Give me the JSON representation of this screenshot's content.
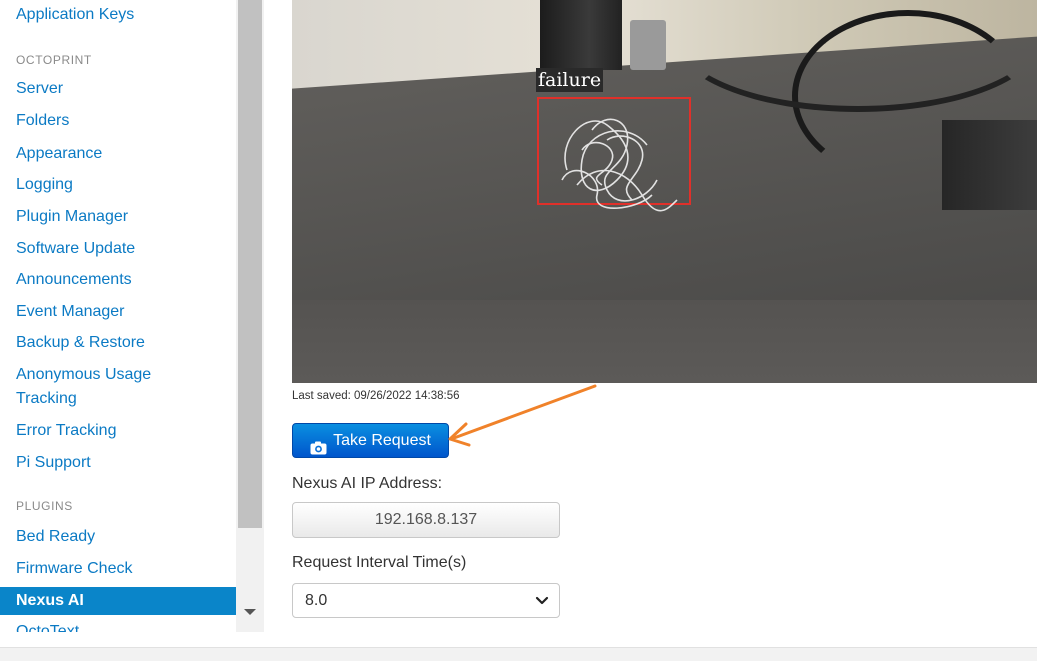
{
  "sidebar": {
    "items": [
      {
        "label": "Application Keys"
      },
      {
        "label": "Server"
      },
      {
        "label": "Folders"
      },
      {
        "label": "Appearance"
      },
      {
        "label": "Logging"
      },
      {
        "label": "Plugin Manager"
      },
      {
        "label": "Software Update"
      },
      {
        "label": "Announcements"
      },
      {
        "label": "Event Manager"
      },
      {
        "label": "Backup & Restore"
      },
      {
        "label": "Anonymous Usage Tracking"
      },
      {
        "label": "Error Tracking"
      },
      {
        "label": "Pi Support"
      },
      {
        "label": "Bed Ready"
      },
      {
        "label": "Firmware Check"
      },
      {
        "label": "Nexus AI"
      },
      {
        "label": "OctoText"
      }
    ],
    "sections": {
      "octoprint": "OCTOPRINT",
      "plugins": "PLUGINS"
    },
    "active_item": "Nexus AI"
  },
  "camera": {
    "detection_label": "failure",
    "last_saved": "Last saved: 09/26/2022 14:38:56"
  },
  "actions": {
    "take_request_label": "Take Request",
    "take_request_icon": "camera-icon"
  },
  "form": {
    "ip_label": "Nexus AI IP Address:",
    "ip_value": "192.168.8.137",
    "interval_label": "Request Interval Time(s)",
    "interval_value": "8.0"
  },
  "colors": {
    "link": "#0b7ac4",
    "active_bg": "#0a85c9",
    "button_blue": "#0066d6",
    "detection_box": "#e0302a",
    "annotation_arrow": "#f0822a"
  }
}
